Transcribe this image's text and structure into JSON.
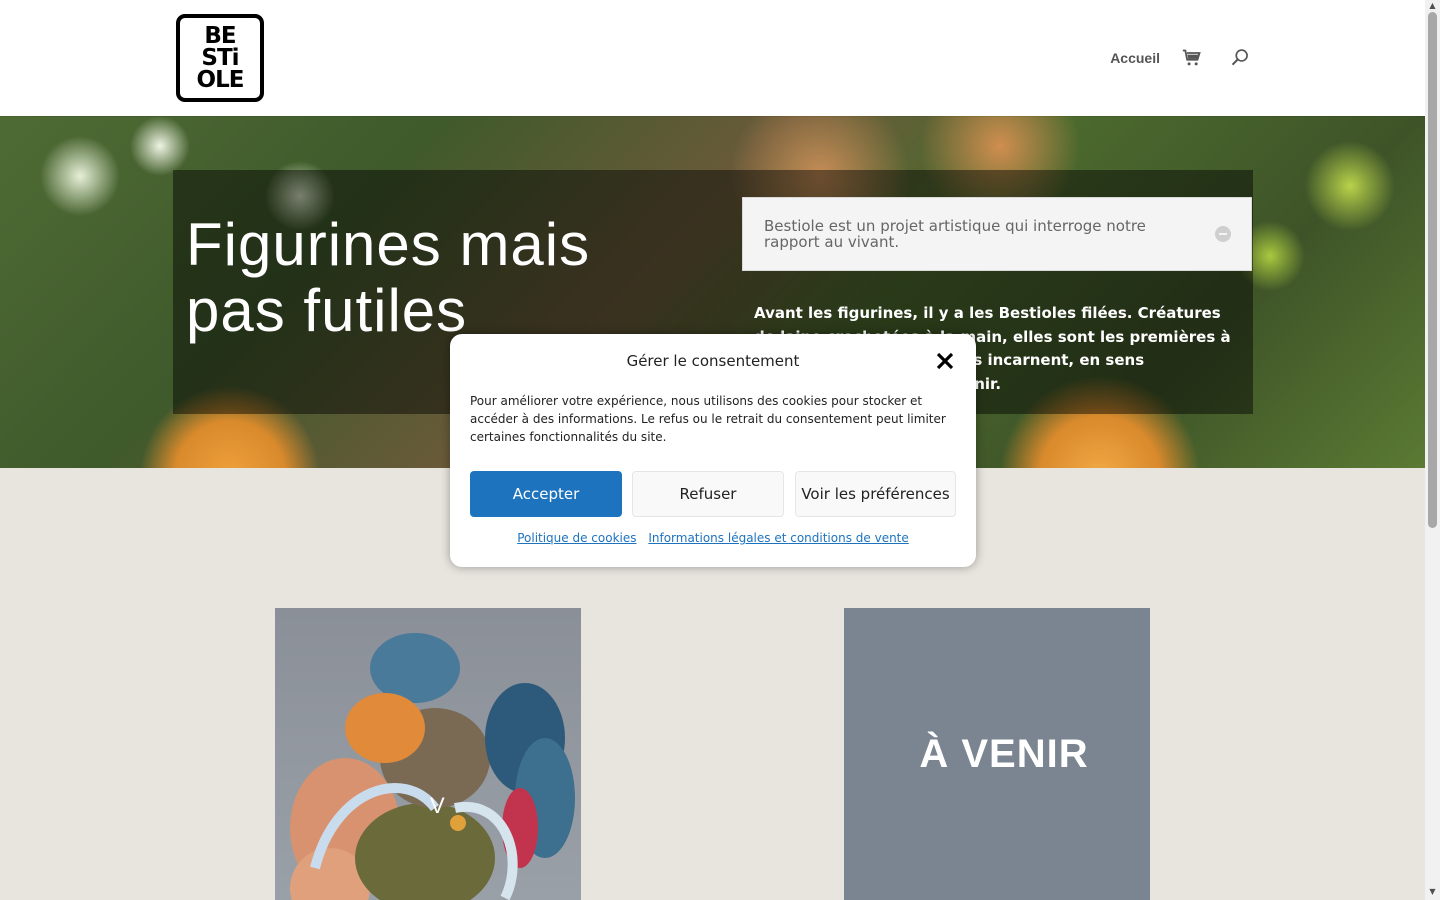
{
  "header": {
    "logo_lines": [
      "BE",
      "STi",
      "OLE"
    ],
    "nav_link": "Accueil",
    "cart_icon": "shopping-cart-icon",
    "search_icon": "search-icon"
  },
  "hero": {
    "title": "Figurines mais pas futiles",
    "accordion_title": "Bestiole est un projet artistique qui interroge notre rapport au vivant.",
    "accordion_icon": "collapse-minus-icon",
    "text": "Avant les figurines, il y a les Bestioles filées. Créatures de laine crochetées à la main, elles sont les premières à sortir de l'imaginaire. Elles incarnent, en sens l'existence, le monde à venir."
  },
  "cards": {
    "coming_soon": "À VENIR"
  },
  "consent": {
    "title": "Gérer le consentement",
    "close_icon": "close-icon",
    "body": "Pour améliorer votre expérience, nous utilisons des cookies pour stocker et accéder à des informations. Le refus ou le retrait du consentement peut limiter certaines fonctionnalités du site.",
    "accept": "Accepter",
    "refuse": "Refuser",
    "preferences": "Voir les préférences",
    "link_cookies": "Politique de cookies",
    "link_legal": "Informations légales et conditions de vente"
  },
  "colors": {
    "accent": "#1e73be",
    "page_background": "#e8e5df",
    "coming_card": "#7b8491"
  }
}
